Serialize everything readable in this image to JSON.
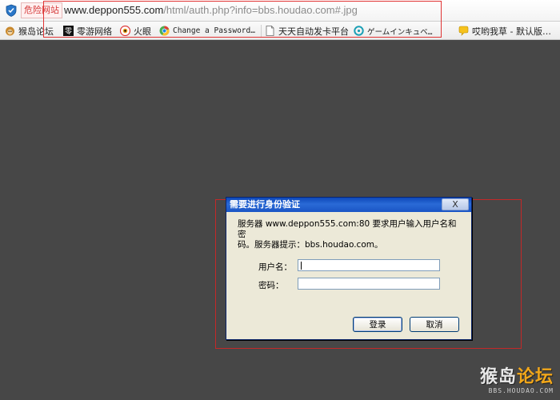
{
  "address_bar": {
    "danger_badge": "危险网站",
    "url_host": "www.deppon555.com",
    "url_rest": "/html/auth.php?info=bbs.houdao.com#.jpg"
  },
  "bookmarks": [
    {
      "label": "猴岛论坛",
      "icon": "monkey-icon"
    },
    {
      "label": "零游网络",
      "icon": "zero-game-icon"
    },
    {
      "label": "火眼",
      "icon": "fire-eye-icon"
    },
    {
      "label": "Change a Password…",
      "icon": "chrome-icon"
    },
    {
      "label": "天天自动发卡平台",
      "icon": "page-icon"
    },
    {
      "label": "ゲームインキュベ…",
      "icon": "circle-icon"
    },
    {
      "label": "哎哟我草 - 默认版…",
      "icon": "bubble-icon"
    }
  ],
  "dialog": {
    "title": "需要进行身份验证",
    "close_label": "X",
    "message_line1": "服务器 www.deppon555.com:80 要求用户输入用户名和密",
    "message_line2": "码。服务器提示：bbs.houdao.com。",
    "username_label": "用户名：",
    "password_label": "密码：",
    "username_value": "",
    "password_value": "",
    "login_button": "登录",
    "cancel_button": "取消"
  },
  "watermark": {
    "text_white": "猴岛",
    "text_orange": "论坛",
    "url": "BBS.HOUDAO.COM"
  }
}
